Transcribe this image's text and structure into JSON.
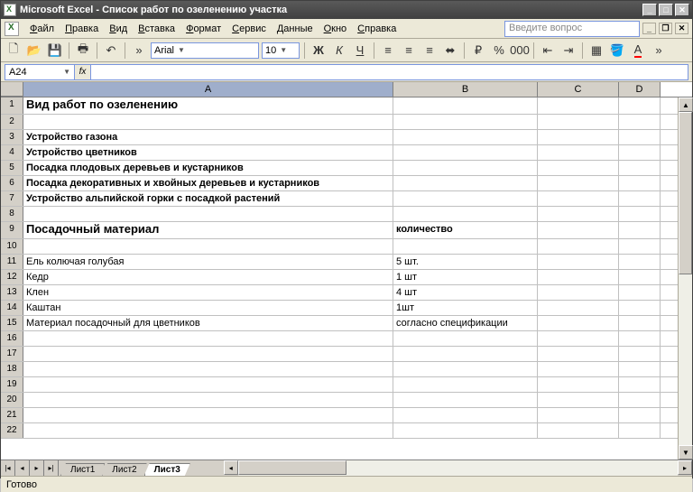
{
  "window": {
    "title": "Microsoft Excel - Список работ по озеленению участка"
  },
  "menus": [
    "Файл",
    "Правка",
    "Вид",
    "Вставка",
    "Формат",
    "Сервис",
    "Данные",
    "Окно",
    "Справка"
  ],
  "ask": {
    "placeholder": "Введите вопрос"
  },
  "toolbar": {
    "font_name": "Arial",
    "font_size": "10"
  },
  "namebox": {
    "value": "A24"
  },
  "columns": [
    "A",
    "B",
    "C",
    "D"
  ],
  "rows": [
    {
      "n": 1,
      "A": "Вид работ по озеленению",
      "B": "",
      "big": true
    },
    {
      "n": 2,
      "A": "",
      "B": ""
    },
    {
      "n": 3,
      "A": "Устройство газона",
      "B": "",
      "bold": true
    },
    {
      "n": 4,
      "A": "Устройство цветников",
      "B": "",
      "bold": true
    },
    {
      "n": 5,
      "A": "Посадка плодовых деревьев и кустарников",
      "B": "",
      "bold": true
    },
    {
      "n": 6,
      "A": "Посадка декоративных и хвойных деревьев и кустарников",
      "B": "",
      "bold": true
    },
    {
      "n": 7,
      "A": "Устройство альпийской горки с посадкой растений",
      "B": "",
      "bold": true
    },
    {
      "n": 8,
      "A": "",
      "B": ""
    },
    {
      "n": 9,
      "A": "Посадочный материал",
      "B": "количество",
      "big": true,
      "bcls": "bold"
    },
    {
      "n": 10,
      "A": "",
      "B": ""
    },
    {
      "n": 11,
      "A": "Ель колючая голубая",
      "B": "5 шт."
    },
    {
      "n": 12,
      "A": "Кедр",
      "B": "1 шт"
    },
    {
      "n": 13,
      "A": "Клен",
      "B": "4 шт"
    },
    {
      "n": 14,
      "A": "Каштан",
      "B": "1шт"
    },
    {
      "n": 15,
      "A": "Материал посадочный для цветников",
      "B": "согласно спецификации"
    },
    {
      "n": 16,
      "A": "",
      "B": ""
    },
    {
      "n": 17,
      "A": "",
      "B": ""
    },
    {
      "n": 18,
      "A": "",
      "B": ""
    },
    {
      "n": 19,
      "A": "",
      "B": ""
    },
    {
      "n": 20,
      "A": "",
      "B": ""
    },
    {
      "n": 21,
      "A": "",
      "B": ""
    },
    {
      "n": 22,
      "A": "",
      "B": ""
    }
  ],
  "sheets": [
    "Лист1",
    "Лист2",
    "Лист3"
  ],
  "active_sheet": 2,
  "status": "Готово"
}
